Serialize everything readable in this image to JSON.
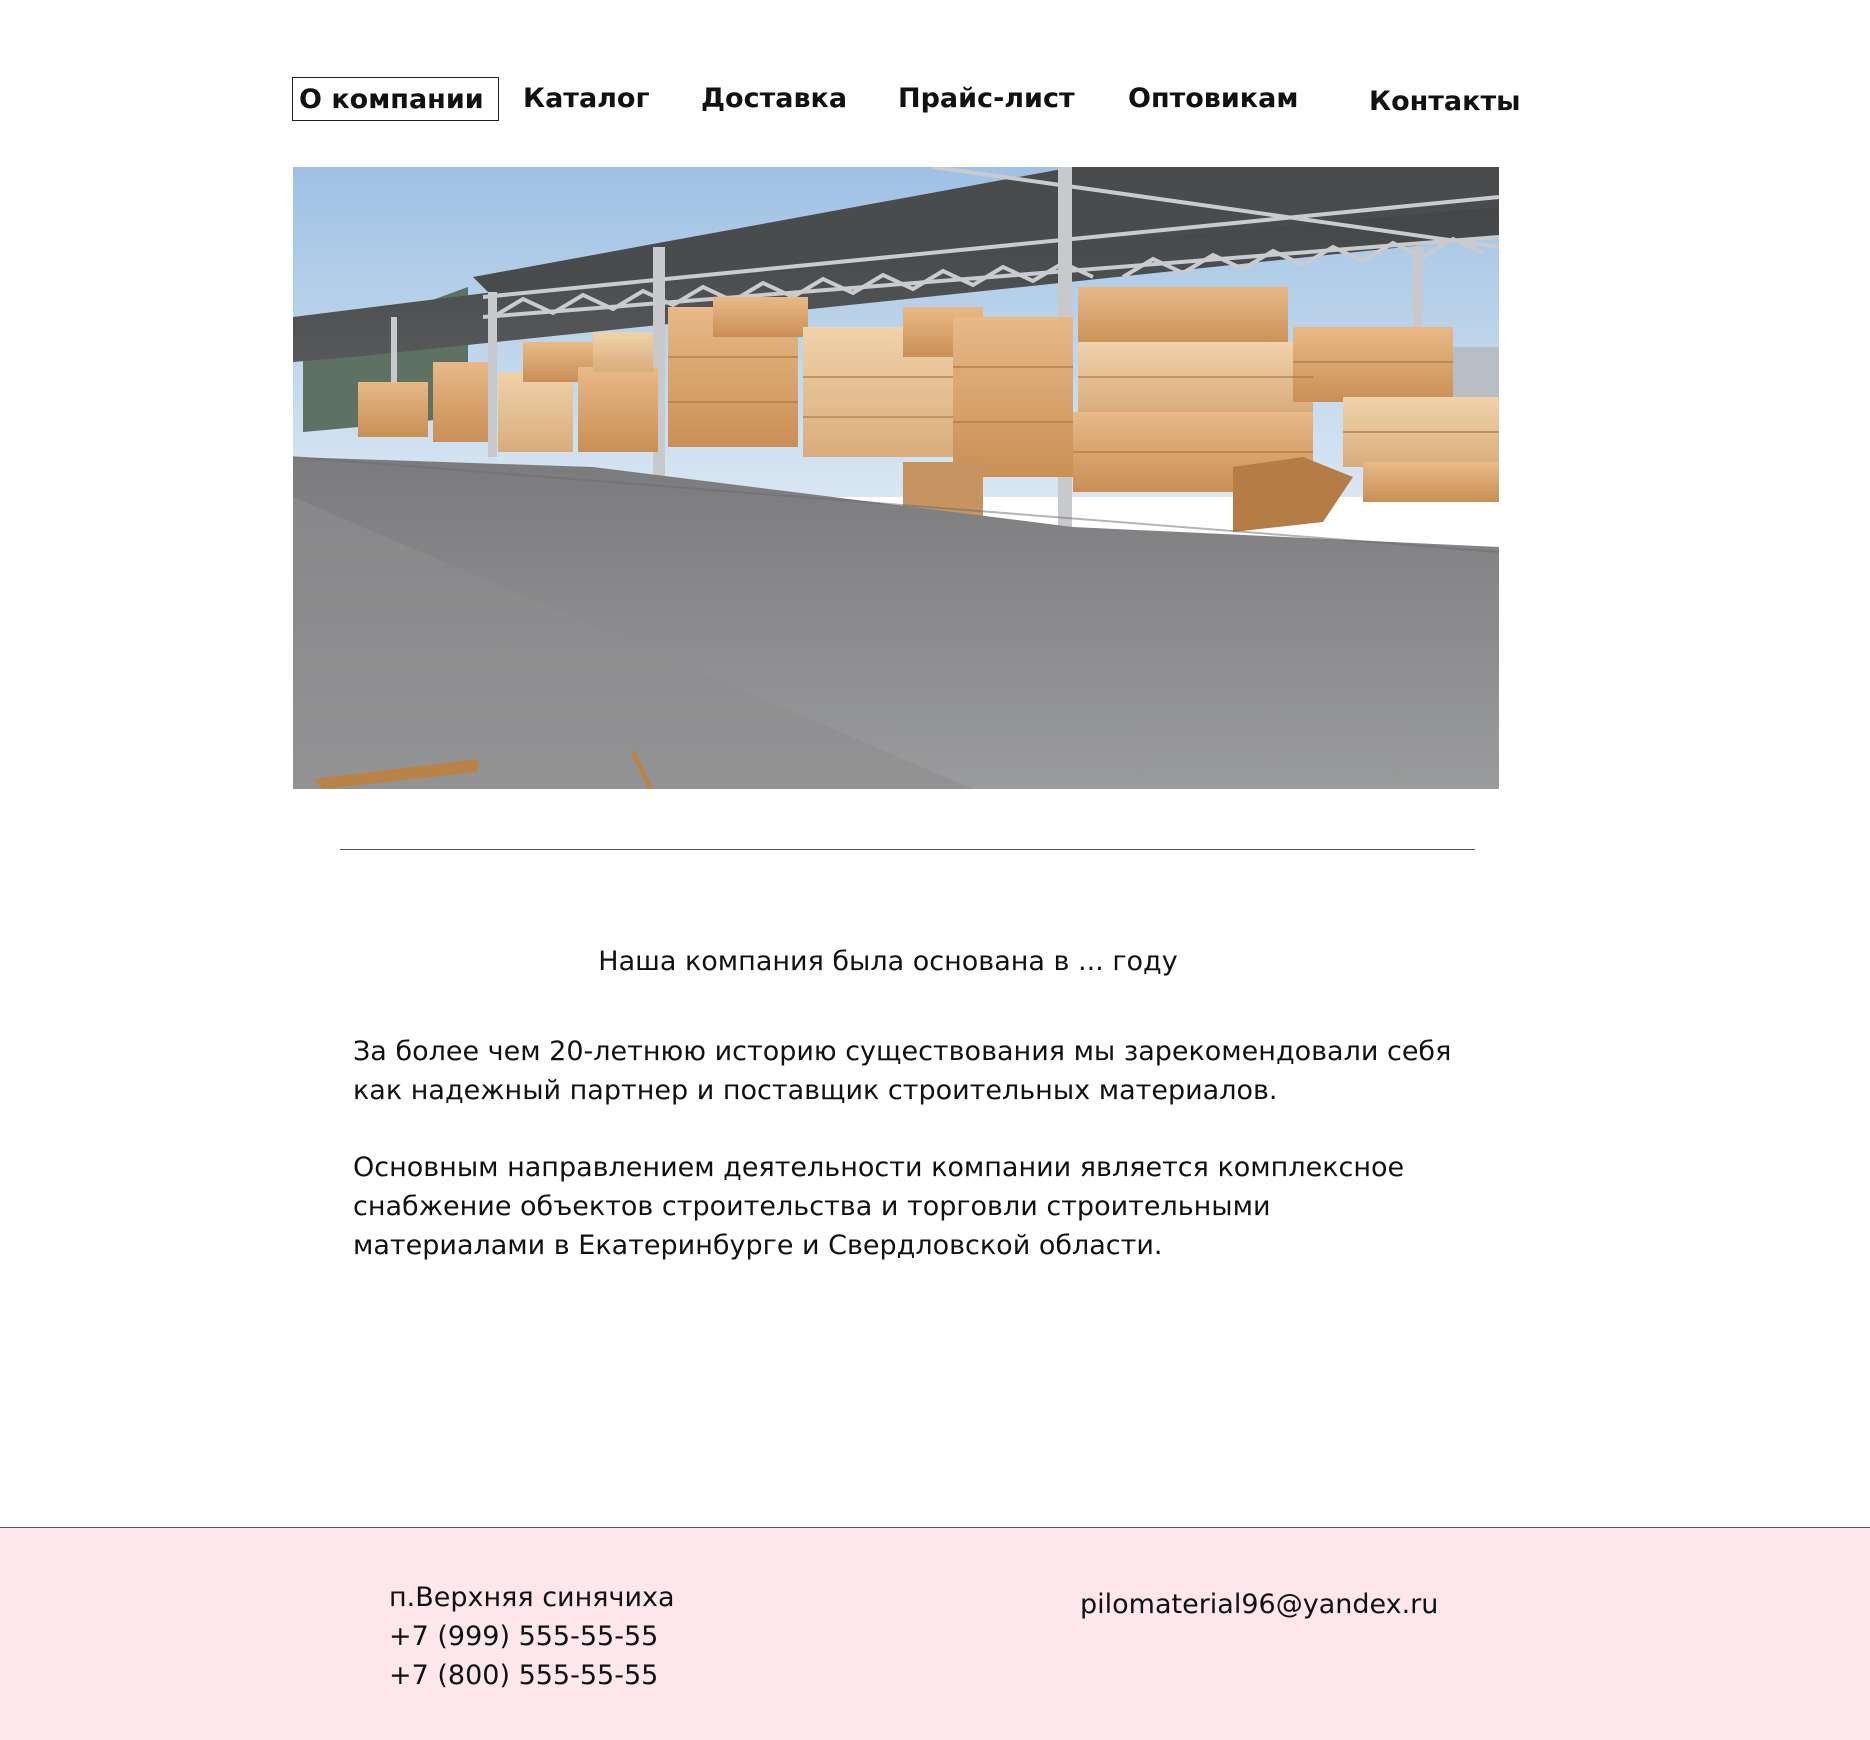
{
  "nav": {
    "items": [
      {
        "label": "О компании",
        "active": true
      },
      {
        "label": "Каталог",
        "active": false
      },
      {
        "label": "Доставка",
        "active": false
      },
      {
        "label": "Прайс-лист",
        "active": false
      },
      {
        "label": "Оптовикам",
        "active": false
      },
      {
        "label": "Контакты",
        "active": false
      }
    ]
  },
  "hero": {
    "image": "lumber-warehouse-photo"
  },
  "content": {
    "intro": "Наша компания была основана в ... году",
    "paragraph1": "За более чем 20-летнюю историю существования мы зарекомендовали себя как надежный партнер и поставщик строительных материалов.",
    "paragraph2": "Основным направлением деятельности компании является комплексное снабжение объектов строительства и торговли строительными материалами в Екатеринбурге и Свердловской области."
  },
  "footer": {
    "address": "п.Верхняя синячиха",
    "phone1": "+7 (999) 555-55-55",
    "phone2": "+7 (800) 555-55-55",
    "email": "pilomaterial96@yandex.ru",
    "background": "#fde7ec"
  }
}
